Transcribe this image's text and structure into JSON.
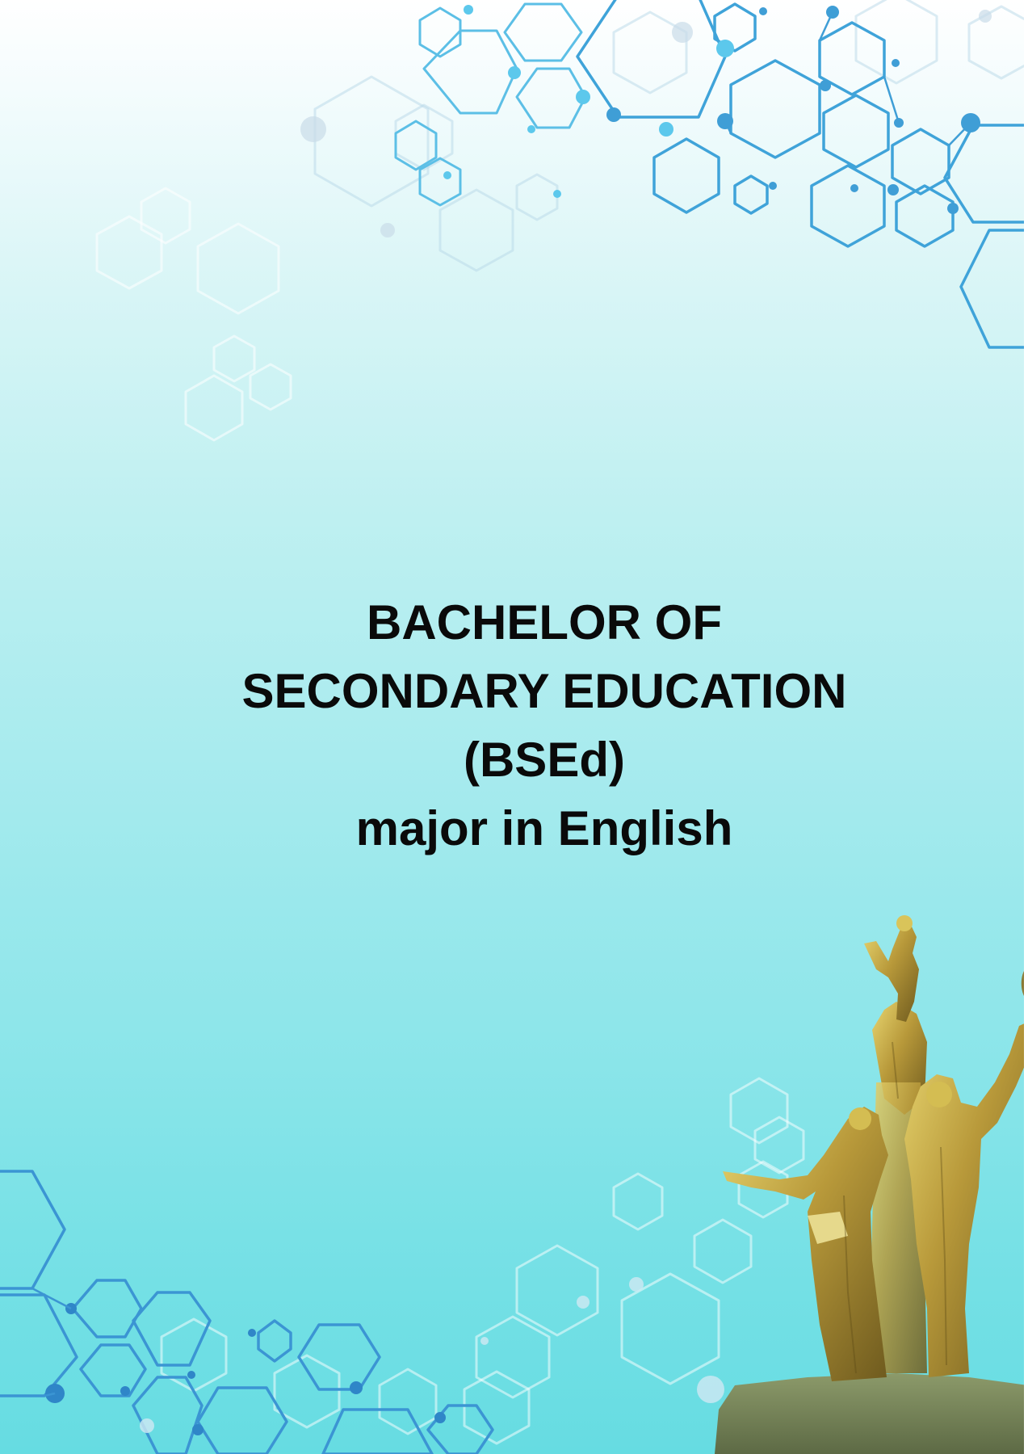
{
  "document": {
    "title_lines": [
      "BACHELOR OF",
      "SECONDARY EDUCATION",
      "(BSEd)",
      "major in English"
    ]
  },
  "colors": {
    "hex_stroke": "#3b9ed6",
    "hex_stroke_light": "#6cc4e8",
    "text": "#0a0a0a",
    "statue_gold": "#b59a3a"
  },
  "icons": {
    "top_right": "hexagon-network-icon",
    "bottom_left": "hexagon-network-icon",
    "statue": "monument-statue-icon"
  }
}
